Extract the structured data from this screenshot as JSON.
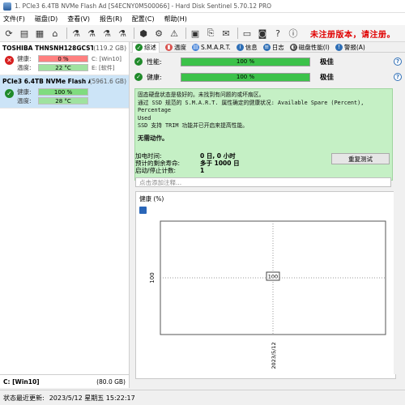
{
  "window": {
    "title": "1. PCIe3 6.4TB NVMe Flash Ad [S4ECNY0M500066]  -  Hard Disk Sentinel 5.70.12 PRO"
  },
  "menu": [
    "文件(F)",
    "磁盘(D)",
    "查看(V)",
    "报告(R)",
    "配置(C)",
    "帮助(H)"
  ],
  "toolbar": {
    "unregistered_text": "未注册版本，请注册。"
  },
  "disks": [
    {
      "name": "TOSHIBA THNSNH128GCST",
      "capacity": "(119.2 GB)",
      "status": "bad",
      "health_label": "健康:",
      "health_value": "0 %",
      "health_fraction": 0.0,
      "temp_label": "温度:",
      "temp_value": "22 °C",
      "volumes": [
        "C: [Win10]",
        "E: [软件]"
      ]
    },
    {
      "name": "PCIe3 6.4TB NVMe Flash Ad",
      "capacity": "(5961.6 GB)",
      "status": "good",
      "health_label": "健康:",
      "health_value": "100 %",
      "health_fraction": 1.0,
      "temp_label": "温度:",
      "temp_value": "28 °C",
      "volumes": []
    }
  ],
  "left_bottom": {
    "volume": "C: [Win10]",
    "size": "(80.0 GB)"
  },
  "statusbar": {
    "label": "状态最近更新:",
    "timestamp": "2023/5/12 星期五 15:22:17"
  },
  "tabs": [
    "综述",
    "温度",
    "S.M.A.R.T.",
    "信息",
    "日志",
    "磁盘性能(I)",
    "警报(A)"
  ],
  "performance": {
    "label": "性能:",
    "value": "100 %",
    "fraction": 1.0,
    "rating": "极佳"
  },
  "health": {
    "label": "健康:",
    "value": "100 %",
    "fraction": 1.0,
    "rating": "极佳"
  },
  "info": {
    "line1": "固态硬盘状态是极好的。未找到有问题的或坏扇区。",
    "line2": "通过 SSD 规范的 S.M.A.R.T. 属性确定的健康状况:   Available Spare (Percent), Percentage",
    "line3": "Used",
    "line4": "SSD 支持 TRIM 功能并已开启来提高性能。",
    "action": "无需动作。"
  },
  "stats": {
    "power_on_label": "加电时间:",
    "power_on_value": "0 日, 0 小时",
    "remaining_label": "预计的剩余寿命:",
    "remaining_value": "多于 1000 日",
    "start_stop_label": "启动/停止计数:",
    "start_stop_value": "1",
    "retest_button": "重复测试"
  },
  "note_placeholder": "点击添加注释...",
  "chart_tab": "健康 (%)",
  "chart_data": {
    "type": "line",
    "title": "",
    "xlabel": "",
    "ylabel": "",
    "x": [
      "2023/5/12"
    ],
    "series": [
      {
        "values": [
          100
        ]
      }
    ],
    "y_tick": "100",
    "data_label": "100"
  }
}
